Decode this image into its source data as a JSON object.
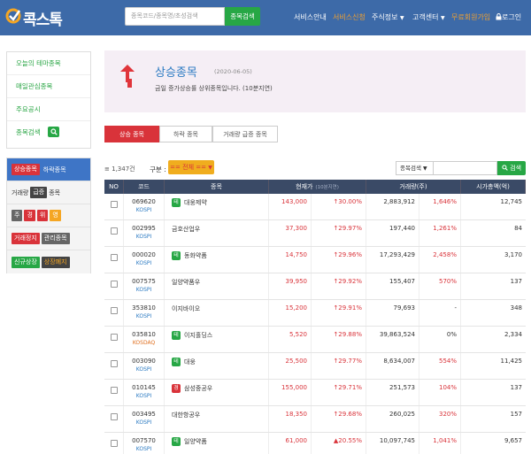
{
  "topbar": {
    "logo_text": "콕스톡",
    "search_placeholder": "종목코드/종목명/초성검색",
    "search_button": "종목검색",
    "nav": {
      "service_info": "서비스안내",
      "service_apply": "서비스신청",
      "stock_info": "주식정보",
      "customer_center": "고객센터",
      "free_signup": "무료회원가입",
      "login": "로그인"
    }
  },
  "sidebar": {
    "menu": [
      {
        "label": "오늘의 테마종목"
      },
      {
        "label": "매일관심종목"
      },
      {
        "label": "주요공시"
      },
      {
        "label": "종목검색"
      }
    ],
    "filters": {
      "row1": {
        "tag1": "상승종목",
        "tag2": "하락종목"
      },
      "row2": {
        "text1": "거래량",
        "tag": "급증",
        "text2": "종목"
      },
      "row3": {
        "t1": "주",
        "t2": "경",
        "t3": "위",
        "t4": "영"
      },
      "row4": {
        "tag1": "거래정지",
        "tag2": "관리종목"
      },
      "row5": {
        "tag1": "신규상장",
        "tag2": "상장폐지"
      }
    }
  },
  "header": {
    "title": "상승종목",
    "date": "(2020-06-05)",
    "description": "금일 증가상승률 상위종목입니다. (10분지연)"
  },
  "tabs": [
    {
      "label": "상승 종목"
    },
    {
      "label": "하락 종목"
    },
    {
      "label": "거래량 급증 종목"
    }
  ],
  "filter_row": {
    "count": "1,347건",
    "gubun_label": "구분 :",
    "category_select": "== 전체 ==",
    "search_type_select": "종목검색",
    "search_button": "검색"
  },
  "table": {
    "headers": {
      "no": "NO",
      "code": "코드",
      "name": "종목",
      "price": "현재가",
      "price_note": "(10분지연)",
      "volume": "거래량(주)",
      "cap": "시가총액(억)"
    },
    "rows": [
      {
        "code": "069620",
        "market": "KOSPI",
        "badge": "테",
        "badge_color": "green",
        "name": "대웅제약",
        "price": "143,000",
        "change": "↑30.00%",
        "volume": "2,883,912",
        "volume_change": "1,646%",
        "cap": "12,745"
      },
      {
        "code": "002995",
        "market": "KOSPI",
        "badge": "",
        "badge_color": "",
        "name": "금호산업우",
        "price": "37,300",
        "change": "↑29.97%",
        "volume": "197,440",
        "volume_change": "1,261%",
        "cap": "84"
      },
      {
        "code": "000020",
        "market": "KOSPI",
        "badge": "테",
        "badge_color": "green",
        "name": "동화약품",
        "price": "14,750",
        "change": "↑29.96%",
        "volume": "17,293,429",
        "volume_change": "2,458%",
        "cap": "3,170"
      },
      {
        "code": "007575",
        "market": "KOSPI",
        "badge": "",
        "badge_color": "",
        "name": "일양약품우",
        "price": "39,950",
        "change": "↑29.92%",
        "volume": "155,407",
        "volume_change": "570%",
        "cap": "137"
      },
      {
        "code": "353810",
        "market": "KOSPI",
        "badge": "",
        "badge_color": "",
        "name": "이지바이오",
        "price": "15,200",
        "change": "↑29.91%",
        "volume": "79,693",
        "volume_change": "-",
        "cap": "348"
      },
      {
        "code": "035810",
        "market": "KOSDAQ",
        "badge": "테",
        "badge_color": "green",
        "name": "이지홀딩스",
        "price": "5,520",
        "change": "↑29.88%",
        "volume": "39,863,524",
        "volume_change": "0%",
        "cap": "2,334"
      },
      {
        "code": "003090",
        "market": "KOSPI",
        "badge": "테",
        "badge_color": "green",
        "name": "대웅",
        "price": "25,500",
        "change": "↑29.77%",
        "volume": "8,634,007",
        "volume_change": "554%",
        "cap": "11,425"
      },
      {
        "code": "010145",
        "market": "KOSPI",
        "badge": "경",
        "badge_color": "red",
        "name": "삼성중공우",
        "price": "155,000",
        "change": "↑29.71%",
        "volume": "251,573",
        "volume_change": "104%",
        "cap": "137"
      },
      {
        "code": "003495",
        "market": "KOSPI",
        "badge": "",
        "badge_color": "",
        "name": "대한항공우",
        "price": "18,350",
        "change": "↑29.68%",
        "volume": "260,025",
        "volume_change": "320%",
        "cap": "157"
      },
      {
        "code": "007570",
        "market": "KOSPI",
        "badge": "테",
        "badge_color": "green",
        "name": "일양약품",
        "price": "61,000",
        "change": "▲20.55%",
        "volume": "10,097,745",
        "volume_change": "1,041%",
        "cap": "9,657"
      }
    ]
  },
  "colors": {
    "nav_bg": "#3d6aa8",
    "accent_green": "#27a745",
    "accent_red": "#d9333a",
    "header_bg": "#f5eef5",
    "table_head": "#3a4a66"
  }
}
